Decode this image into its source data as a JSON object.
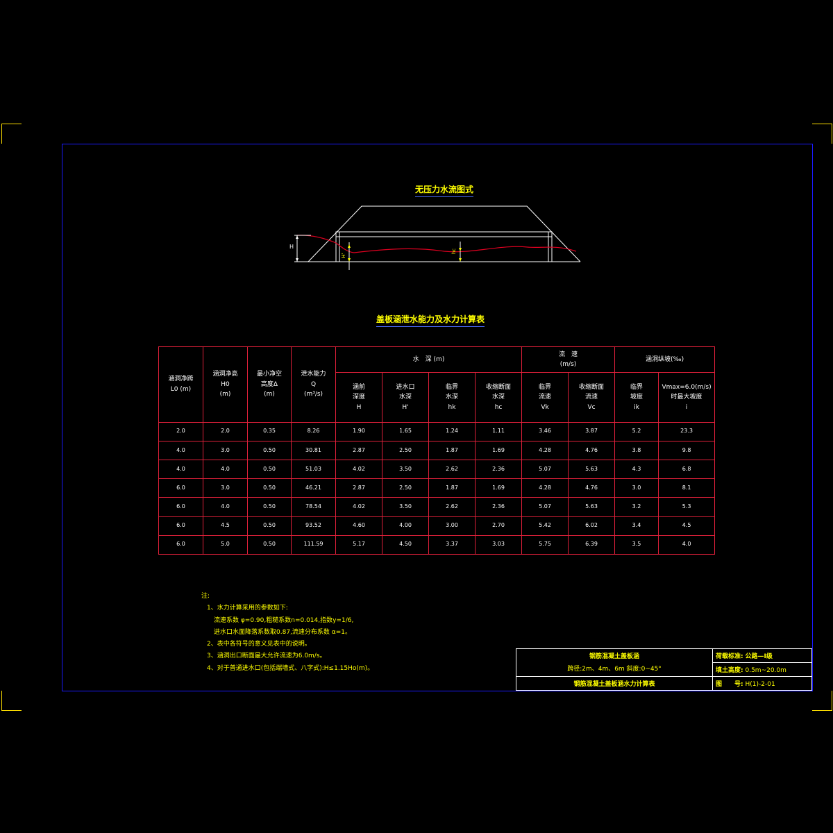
{
  "diagram": {
    "title": "无压力水流图式",
    "labels": {
      "H": "H",
      "Hprime": "H'",
      "hc": "hc"
    }
  },
  "table": {
    "title": "盖板涵泄水能力及水力计算表",
    "headers": {
      "L0": [
        "涵洞净跨",
        "L0 (m)"
      ],
      "H0": [
        "涵洞净高",
        "H0",
        "(m)"
      ],
      "delta": [
        "最小净空",
        "高度Δ",
        "(m)"
      ],
      "Q": [
        "泄水能力",
        "Q",
        "(m³/s)"
      ],
      "water_depth": "水　深 (m)",
      "velocity": [
        "流　速",
        "(m/s)"
      ],
      "slope": "涵洞纵坡(‰)",
      "H": [
        "涵前",
        "深度",
        "H"
      ],
      "Hp": [
        "进水口",
        "水深",
        "H'"
      ],
      "hk": [
        "临界",
        "水深",
        "hk"
      ],
      "hc": [
        "收缩断面",
        "水深",
        "hc"
      ],
      "Vk": [
        "临界",
        "流速",
        "Vk"
      ],
      "Vc": [
        "收缩断面",
        "流速",
        "Vc"
      ],
      "ik": [
        "临界",
        "坡度",
        "ik"
      ],
      "i": [
        "Vmax=6.0(m/s)",
        "时最大坡度",
        "i"
      ]
    },
    "rows": [
      [
        "2.0",
        "2.0",
        "0.35",
        "8.26",
        "1.90",
        "1.65",
        "1.24",
        "1.11",
        "3.46",
        "3.87",
        "5.2",
        "23.3"
      ],
      [
        "4.0",
        "3.0",
        "0.50",
        "30.81",
        "2.87",
        "2.50",
        "1.87",
        "1.69",
        "4.28",
        "4.76",
        "3.8",
        "9.8"
      ],
      [
        "4.0",
        "4.0",
        "0.50",
        "51.03",
        "4.02",
        "3.50",
        "2.62",
        "2.36",
        "5.07",
        "5.63",
        "4.3",
        "6.8"
      ],
      [
        "6.0",
        "3.0",
        "0.50",
        "46.21",
        "2.87",
        "2.50",
        "1.87",
        "1.69",
        "4.28",
        "4.76",
        "3.0",
        "8.1"
      ],
      [
        "6.0",
        "4.0",
        "0.50",
        "78.54",
        "4.02",
        "3.50",
        "2.62",
        "2.36",
        "5.07",
        "5.63",
        "3.2",
        "5.3"
      ],
      [
        "6.0",
        "4.5",
        "0.50",
        "93.52",
        "4.60",
        "4.00",
        "3.00",
        "2.70",
        "5.42",
        "6.02",
        "3.4",
        "4.5"
      ],
      [
        "6.0",
        "5.0",
        "0.50",
        "111.59",
        "5.17",
        "4.50",
        "3.37",
        "3.03",
        "5.75",
        "6.39",
        "3.5",
        "4.0"
      ]
    ]
  },
  "notes": [
    "注:",
    "1、水力计算采用的参数如下:",
    "流速系数 φ=0.90,粗糙系数n=0.014,指数y=1/6,",
    "进水口水面降落系数取0.87,流速分布系数 α=1。",
    "2、表中各符号的意义见表中的说明。",
    "3、涵洞出口断面最大允许流速为6.0m/s。",
    "4、对于普通进水口(包括端墙式、八字式):H≤1.15Ho(m)。"
  ],
  "title_block": {
    "name1": "钢筋混凝土盖板涵",
    "name2": "跨径:2m、4m、6m  斜度:0~45°",
    "sheet_title": "钢筋混凝土盖板涵水力计算表",
    "load_label": "荷载标准:",
    "load_value": "公路—I级",
    "fill_label": "填土高度:",
    "fill_value": "0.5m~20.0m",
    "drawing_label": "图　　号:",
    "drawing_value": "H(1)-2-01"
  },
  "colors": {
    "background": "#000000",
    "frame": "#1a1aff",
    "corner": "#ffe000",
    "table_border": "#e0203a",
    "text_yellow": "#ffff00",
    "water_line": "#e00020"
  }
}
